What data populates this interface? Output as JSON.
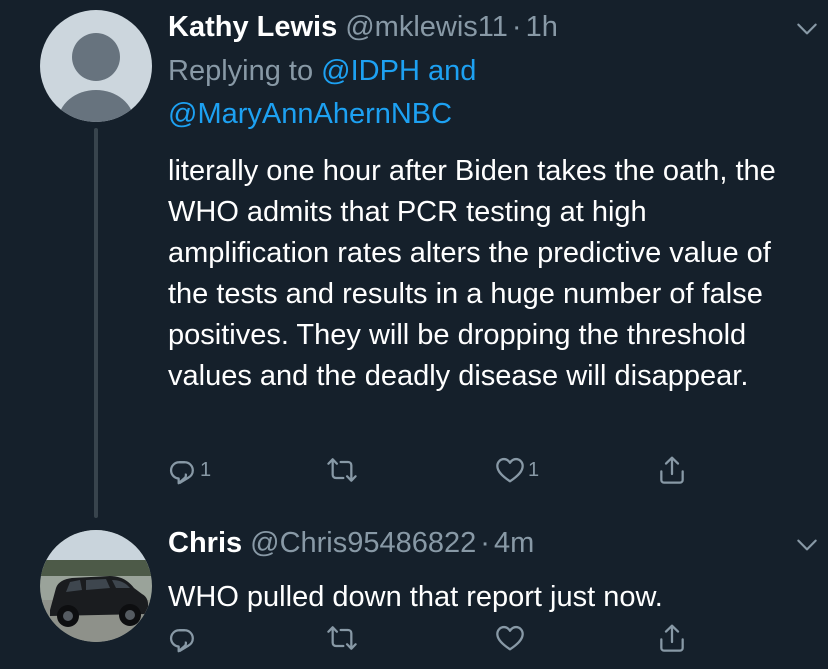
{
  "tweets": [
    {
      "display_name": "Kathy Lewis",
      "handle": "@mklewis11",
      "separator": "·",
      "time": "1h",
      "reply_prefix": "Replying to ",
      "reply_mention_1": "@IDPH",
      "reply_and": " and",
      "reply_mention_2": "@MaryAnnAhernNBC",
      "text": "literally one hour after Biden takes the oath, the WHO admits that PCR testing at high amplification rates alters the predictive value of the tests and results in a huge number of false positives. They will be dropping the threshold values and the deadly disease will disappear.",
      "reply_count": "1",
      "retweet_count": "",
      "like_count": "1",
      "avatar_icon": "default-profile-icon"
    },
    {
      "display_name": "Chris",
      "handle": "@Chris95486822",
      "separator": "·",
      "time": "4m",
      "text": "WHO pulled down that report just now.",
      "reply_count": "",
      "retweet_count": "",
      "like_count": "",
      "avatar_icon": "black-suv-photo"
    }
  ],
  "colors": {
    "background": "#15202b",
    "text": "#ffffff",
    "secondary": "#8899a6",
    "link": "#1da1f2",
    "thread_line": "#38444d"
  }
}
